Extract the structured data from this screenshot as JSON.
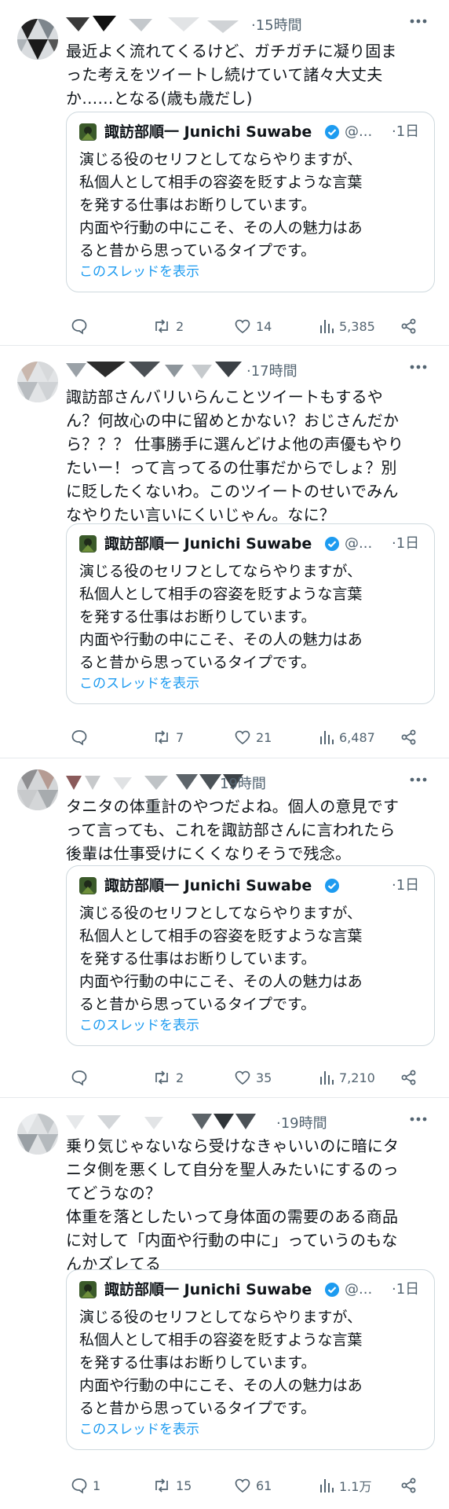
{
  "quoted": {
    "name": "諏訪部順一 Junichi Suwabe",
    "handle": "@...",
    "time": "·1日",
    "text": "演じる役のセリフとしてならやりますが、\n私個人として相手の容姿を貶すような言葉\nを発する仕事はお断りしています。\n内面や行動の中にこそ、その人の魅力はあ\nると昔から思っているタイプです。",
    "show_thread": "このスレッドを表示"
  },
  "tweets": [
    {
      "time": "·15時間",
      "text": "最近よく流れてくるけど、ガチガチに凝り固ま\nった考えをツイートし続けていて諸々大丈夫\nか……となる(歳も歳だし)",
      "replies": "",
      "retweets": "2",
      "likes": "14",
      "views": "5,385"
    },
    {
      "time": "·17時間",
      "text": "諏訪部さんバリいらんことツイートもするや\nん？何故心の中に留めとかない？おじさんだか\nら？？？ 仕事勝手に選んどけよ他の声優もやり\nたいー！って言ってるの仕事だからでしょ？別\nに貶したくないわ。このツイートのせいでみん\nなやりたい言いにくいじゃん。なに？",
      "replies": "",
      "retweets": "7",
      "likes": "21",
      "views": "6,487"
    },
    {
      "time": "19時間",
      "text": "タニタの体重計のやつだよね。個人の意見です\nって言っても、これを諏訪部さんに言われたら\n後輩は仕事受けにくくなりそうで残念。",
      "replies": "",
      "retweets": "2",
      "likes": "35",
      "views": "7,210"
    },
    {
      "time": "·19時間",
      "text": "乗り気じゃないなら受けなきゃいいのに暗にタ\nニタ側を悪くして自分を聖人みたいにするのっ\nてどうなの？\n体重を落としたいって身体面の需要のある商品\nに対して「内面や行動の中に」っていうのもな\nんかズレてる",
      "replies": "1",
      "retweets": "15",
      "likes": "61",
      "views": "1.1万"
    }
  ],
  "colors": {
    "link": "#1d9bf0",
    "verified": "#1d9bf0",
    "muted": "#536471",
    "border": "#cfd9de"
  },
  "icons": [
    "reply-icon",
    "retweet-icon",
    "like-icon",
    "views-icon",
    "share-icon",
    "verified-icon",
    "more-icon"
  ]
}
